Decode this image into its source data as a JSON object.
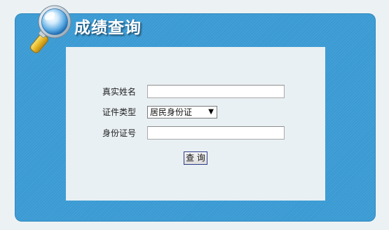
{
  "header": {
    "title": "成绩查询",
    "icon": "magnifier-icon"
  },
  "form": {
    "name_label": "真实姓名",
    "name_value": "",
    "id_type_label": "证件类型",
    "id_type_selected": "居民身份证",
    "id_number_label": "身份证号",
    "id_number_value": "",
    "submit_label": "查 询"
  },
  "colors": {
    "panel_blue": "#3a9ad3",
    "content_bg": "#e9f0f3",
    "page_bg": "#ecf2f4"
  }
}
